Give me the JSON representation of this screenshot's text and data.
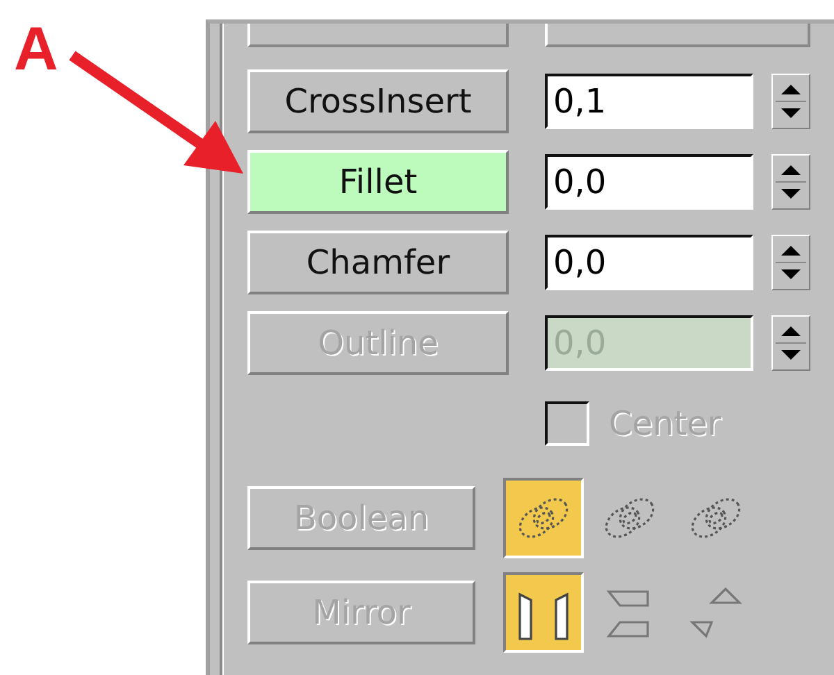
{
  "annotation": {
    "label": "A"
  },
  "rows": [
    {
      "button": "CrossInsert",
      "value": "0,1",
      "highlighted": false,
      "disabled": false
    },
    {
      "button": "Fillet",
      "value": "0,0",
      "highlighted": true,
      "disabled": false
    },
    {
      "button": "Chamfer",
      "value": "0,0",
      "highlighted": false,
      "disabled": false
    },
    {
      "button": "Outline",
      "value": "0,0",
      "highlighted": false,
      "disabled": true
    }
  ],
  "center": {
    "label": "Center",
    "checked": false,
    "disabled": true
  },
  "modes": [
    {
      "button": "Boolean",
      "disabled": true,
      "options": [
        {
          "kind": "union",
          "selected": true
        },
        {
          "kind": "subtract",
          "selected": false
        },
        {
          "kind": "intersect",
          "selected": false
        }
      ]
    },
    {
      "button": "Mirror",
      "disabled": true,
      "options": [
        {
          "kind": "horizontal",
          "selected": true
        },
        {
          "kind": "vertical",
          "selected": false
        },
        {
          "kind": "diagonal",
          "selected": false
        }
      ]
    }
  ]
}
